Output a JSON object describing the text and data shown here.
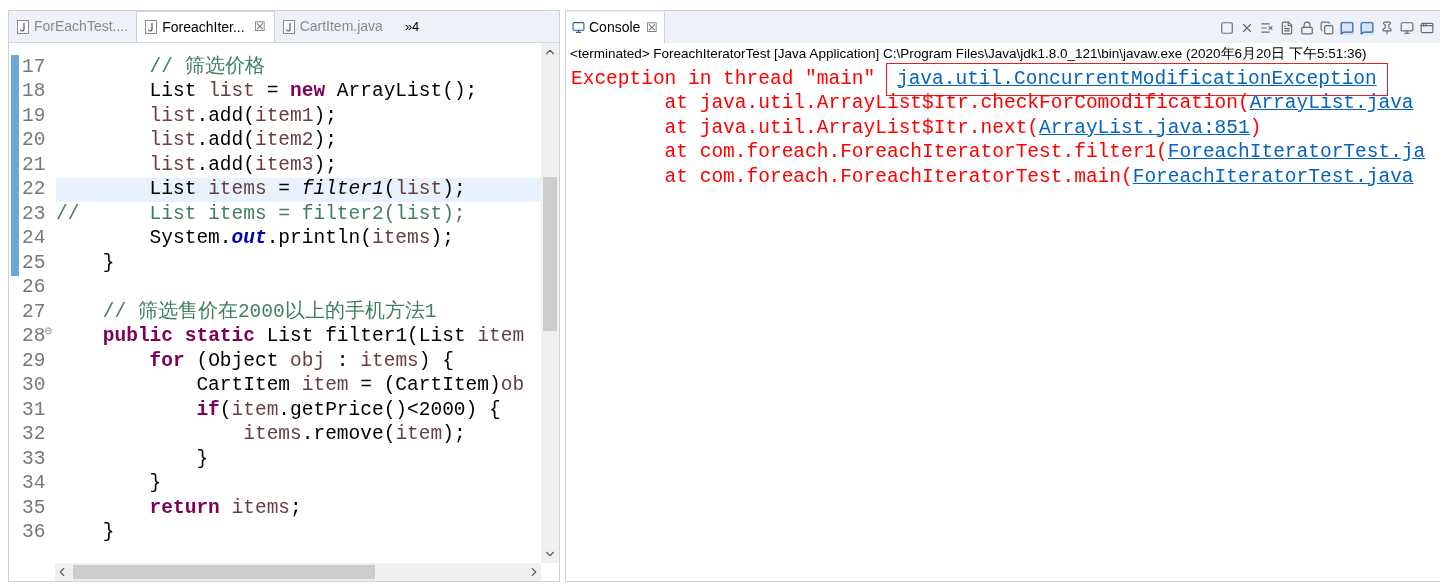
{
  "editor": {
    "tabs": [
      {
        "label": "ForEachTest....",
        "selected": false
      },
      {
        "label": "ForeachIter...",
        "selected": true,
        "close": "☒"
      },
      {
        "label": "CartItem.java",
        "selected": false
      }
    ],
    "overflow": "»4",
    "lines": [
      {
        "number": "17",
        "changed": true,
        "current": false,
        "tokens": [
          {
            "t": "        // 筛选价格",
            "kind": "comment"
          }
        ]
      },
      {
        "number": "18",
        "changed": true,
        "current": false,
        "tokens": [
          {
            "t": "        List ",
            "kind": "plain"
          },
          {
            "t": "list",
            "kind": "var"
          },
          {
            "t": " = ",
            "kind": "plain"
          },
          {
            "t": "new",
            "kind": "kw"
          },
          {
            "t": " ArrayList();",
            "kind": "plain"
          }
        ]
      },
      {
        "number": "19",
        "changed": true,
        "current": false,
        "tokens": [
          {
            "t": "        list",
            "kind": "var"
          },
          {
            "t": ".add(",
            "kind": "plain"
          },
          {
            "t": "item1",
            "kind": "var"
          },
          {
            "t": ");",
            "kind": "plain"
          }
        ]
      },
      {
        "number": "20",
        "changed": true,
        "current": false,
        "tokens": [
          {
            "t": "        list",
            "kind": "var"
          },
          {
            "t": ".add(",
            "kind": "plain"
          },
          {
            "t": "item2",
            "kind": "var"
          },
          {
            "t": ");",
            "kind": "plain"
          }
        ]
      },
      {
        "number": "21",
        "changed": true,
        "current": false,
        "tokens": [
          {
            "t": "        list",
            "kind": "var"
          },
          {
            "t": ".add(",
            "kind": "plain"
          },
          {
            "t": "item3",
            "kind": "var"
          },
          {
            "t": ");",
            "kind": "plain"
          }
        ]
      },
      {
        "number": "22",
        "changed": true,
        "current": true,
        "tokens": [
          {
            "t": "        List ",
            "kind": "plain"
          },
          {
            "t": "items",
            "kind": "var"
          },
          {
            "t": " = ",
            "kind": "plain"
          },
          {
            "t": "filter1",
            "kind": "static"
          },
          {
            "t": "(",
            "kind": "plain"
          },
          {
            "t": "list",
            "kind": "var"
          },
          {
            "t": ");",
            "kind": "plain"
          }
        ]
      },
      {
        "number": "23",
        "changed": true,
        "current": false,
        "tokens": [
          {
            "t": "//      List items = filter2(list);",
            "kind": "comment"
          }
        ]
      },
      {
        "number": "24",
        "changed": true,
        "current": false,
        "tokens": [
          {
            "t": "        System.",
            "kind": "plain"
          },
          {
            "t": "out",
            "kind": "field"
          },
          {
            "t": ".println(",
            "kind": "plain"
          },
          {
            "t": "items",
            "kind": "var"
          },
          {
            "t": ");",
            "kind": "plain"
          }
        ]
      },
      {
        "number": "25",
        "changed": true,
        "current": false,
        "tokens": [
          {
            "t": "    }",
            "kind": "plain"
          }
        ]
      },
      {
        "number": "26",
        "changed": false,
        "current": false
      },
      {
        "number": "27",
        "changed": false,
        "current": false,
        "tokens": [
          {
            "t": "    // 筛选售价在2000以上的手机方法1",
            "kind": "comment"
          }
        ]
      },
      {
        "number": "28",
        "changed": false,
        "current": false,
        "fold": "⊖",
        "tokens": [
          {
            "t": "    public",
            "kind": "kw"
          },
          {
            "t": " static",
            "kind": "kw"
          },
          {
            "t": " List filter1(List ",
            "kind": "plain"
          },
          {
            "t": "item",
            "kind": "var"
          }
        ]
      },
      {
        "number": "29",
        "changed": false,
        "current": false,
        "tokens": [
          {
            "t": "        for",
            "kind": "kw"
          },
          {
            "t": " (Object ",
            "kind": "plain"
          },
          {
            "t": "obj",
            "kind": "var"
          },
          {
            "t": " : ",
            "kind": "plain"
          },
          {
            "t": "items",
            "kind": "var"
          },
          {
            "t": ") {",
            "kind": "plain"
          }
        ]
      },
      {
        "number": "30",
        "changed": false,
        "current": false,
        "tokens": [
          {
            "t": "            CartItem ",
            "kind": "plain"
          },
          {
            "t": "item",
            "kind": "var"
          },
          {
            "t": " = (CartItem)",
            "kind": "plain"
          },
          {
            "t": "ob",
            "kind": "var"
          }
        ]
      },
      {
        "number": "31",
        "changed": false,
        "current": false,
        "tokens": [
          {
            "t": "            if",
            "kind": "kw"
          },
          {
            "t": "(",
            "kind": "plain"
          },
          {
            "t": "item",
            "kind": "var"
          },
          {
            "t": ".getPrice()<2000) {",
            "kind": "plain"
          }
        ]
      },
      {
        "number": "32",
        "changed": false,
        "current": false,
        "tokens": [
          {
            "t": "                items",
            "kind": "var"
          },
          {
            "t": ".remove(",
            "kind": "plain"
          },
          {
            "t": "item",
            "kind": "var"
          },
          {
            "t": ");",
            "kind": "plain"
          }
        ]
      },
      {
        "number": "33",
        "changed": false,
        "current": false,
        "tokens": [
          {
            "t": "            }",
            "kind": "plain"
          }
        ]
      },
      {
        "number": "34",
        "changed": false,
        "current": false,
        "tokens": [
          {
            "t": "        }",
            "kind": "plain"
          }
        ]
      },
      {
        "number": "35",
        "changed": false,
        "current": false,
        "tokens": [
          {
            "t": "        return",
            "kind": "kw"
          },
          {
            "t": " items",
            "kind": "var"
          },
          {
            "t": ";",
            "kind": "plain"
          }
        ]
      },
      {
        "number": "36",
        "changed": false,
        "current": false,
        "tokens": [
          {
            "t": "    }",
            "kind": "plain"
          }
        ]
      }
    ]
  },
  "console": {
    "tab": {
      "label": "Console",
      "close": "☒"
    },
    "description": "<terminated> ForeachIteratorTest [Java Application] C:\\Program Files\\Java\\jdk1.8.0_121\\bin\\javaw.exe (2020年6月20日 下午5:51:36)",
    "lines": [
      {
        "tokens": [
          {
            "t": "Exception in thread \"main\" ",
            "kind": "error"
          },
          {
            "t": "java.util.ConcurrentModificationException",
            "kind": "link",
            "boxed": true
          }
        ]
      },
      {
        "tokens": [
          {
            "t": "        at java.util.ArrayList$Itr.checkForComodification(",
            "kind": "error"
          },
          {
            "t": "ArrayList.java",
            "kind": "link"
          }
        ]
      },
      {
        "tokens": [
          {
            "t": "        at java.util.ArrayList$Itr.next(",
            "kind": "error"
          },
          {
            "t": "ArrayList.java:851",
            "kind": "link"
          },
          {
            "t": ")",
            "kind": "error"
          }
        ]
      },
      {
        "tokens": [
          {
            "t": "        at com.foreach.ForeachIteratorTest.filter1(",
            "kind": "error"
          },
          {
            "t": "ForeachIteratorTest.ja",
            "kind": "link"
          }
        ]
      },
      {
        "tokens": [
          {
            "t": "        at com.foreach.ForeachIteratorTest.main(",
            "kind": "error"
          },
          {
            "t": "ForeachIteratorTest.java",
            "kind": "link"
          }
        ]
      }
    ]
  }
}
